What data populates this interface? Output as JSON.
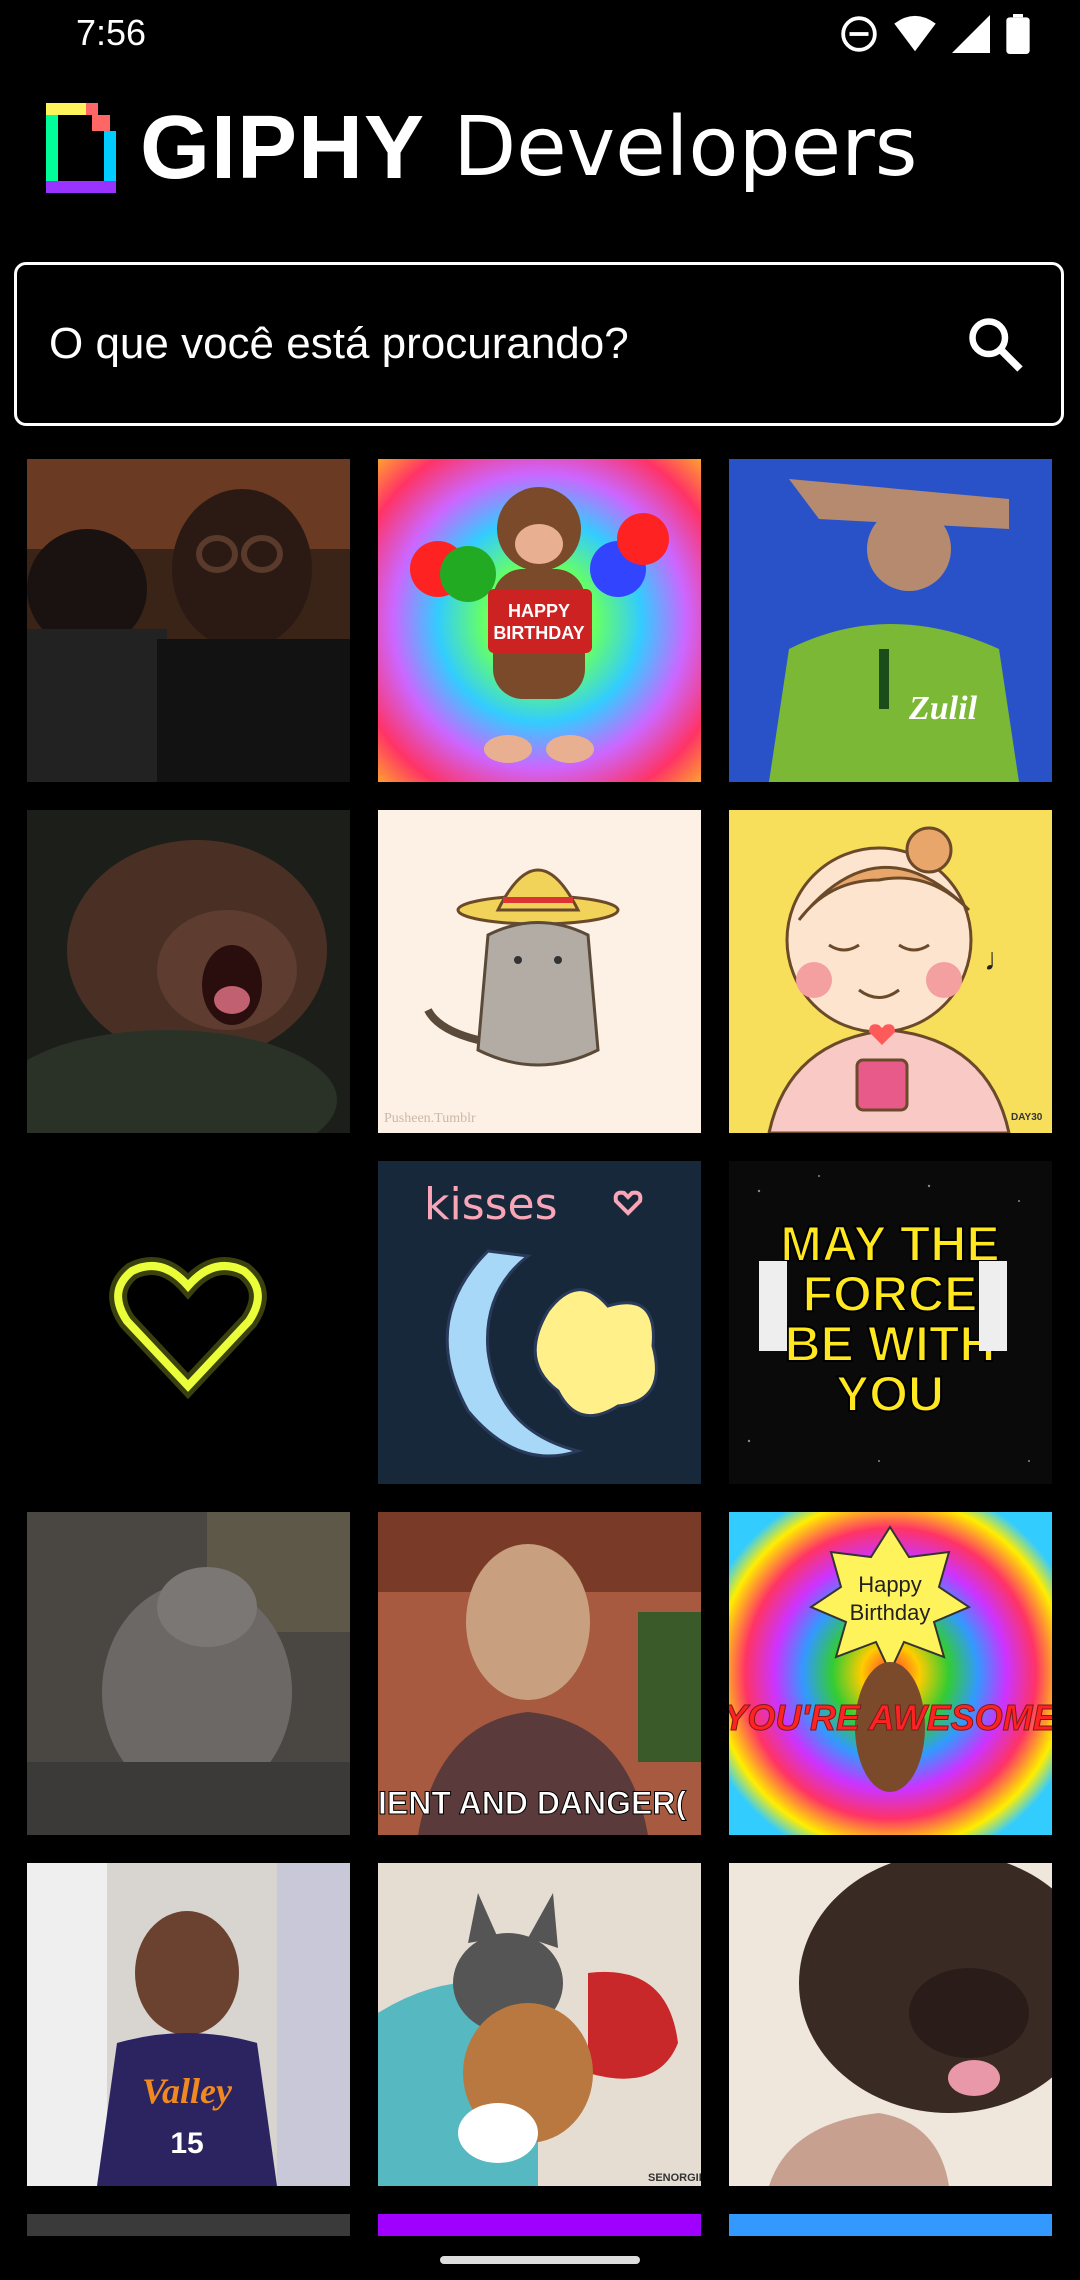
{
  "status_bar": {
    "time": "7:56",
    "icons": [
      "do-not-disturb-icon",
      "wifi-icon",
      "cell-signal-icon",
      "battery-icon"
    ]
  },
  "brand": {
    "name": "GIPHY",
    "suffix": "Developers",
    "logo_colors": [
      "#00ff99",
      "#00ccff",
      "#9933ff",
      "#ff6666",
      "#fff35c"
    ]
  },
  "search": {
    "placeholder": "O que você está procurando?",
    "value": ""
  },
  "grid": {
    "tiles": [
      {
        "name": "gif-basketball-fans-goggles"
      },
      {
        "name": "gif-monkey-happy-birthday",
        "caption": "HAPPY BIRTHDAY"
      },
      {
        "name": "gif-soccer-player-salute",
        "caption": "Zulil"
      },
      {
        "name": "gif-sloth-yawning"
      },
      {
        "name": "gif-pusheen-sombrero",
        "caption": "Pusheen.Tumblr"
      },
      {
        "name": "gif-cartoon-girl-coffee-heart",
        "caption": "DAY30"
      },
      {
        "name": "gif-neon-yellow-heart"
      },
      {
        "name": "gif-kisses-moon-star",
        "caption": "kisses"
      },
      {
        "name": "gif-may-the-force-be-with-you",
        "caption": "MAY THE FORCE BE WITH YOU"
      },
      {
        "name": "gif-sleeping-white-kitten"
      },
      {
        "name": "gif-man-talking-dangerous",
        "caption": "IENT AND DANGER("
      },
      {
        "name": "gif-happy-birthday-youre-awesome",
        "caption_top": "Happy Birthday",
        "caption_bottom": "YOU'RE AWESOME"
      },
      {
        "name": "gif-basketball-player-laughing",
        "caption": "Valley"
      },
      {
        "name": "gif-cat-hugging-teddy"
      },
      {
        "name": "gif-dog-licking"
      }
    ]
  },
  "colors": {
    "background": "#000000",
    "text": "#ffffff",
    "partial_row": [
      "#3a3a3a",
      "#a000ff",
      "#3399ff"
    ]
  }
}
